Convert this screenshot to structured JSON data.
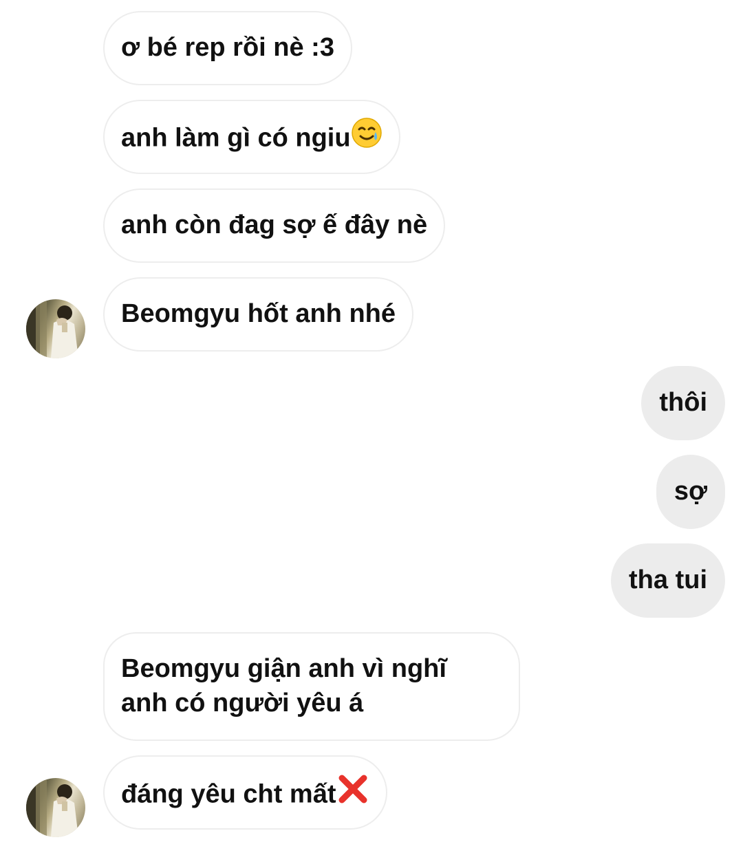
{
  "messages": [
    {
      "id": "m1",
      "side": "incoming",
      "text": "ơ bé rep rồi nè :3"
    },
    {
      "id": "m2",
      "side": "incoming",
      "text": "anh làm gì có ngiu",
      "emoji": "smiling-face-with-tear-emoji"
    },
    {
      "id": "m3",
      "side": "incoming",
      "text": "anh còn đag sợ ế đây nè"
    },
    {
      "id": "m4",
      "side": "incoming",
      "text": "Beomgyu hốt anh nhé",
      "avatar": true
    },
    {
      "id": "m5",
      "side": "outgoing",
      "text": "thôi"
    },
    {
      "id": "m6",
      "side": "outgoing",
      "text": "sợ"
    },
    {
      "id": "m7",
      "side": "outgoing",
      "text": "tha tui"
    },
    {
      "id": "m8",
      "side": "incoming",
      "text_lines": [
        "Beomgyu giận anh vì nghĩ",
        "anh có người yêu á"
      ]
    },
    {
      "id": "m9",
      "side": "incoming",
      "text": "đáng yêu cht mất",
      "emoji": "cross-mark-emoji",
      "avatar": true
    }
  ],
  "colors": {
    "incoming_bubble_bg": "#ffffff",
    "incoming_bubble_border": "#ededed",
    "outgoing_bubble_bg": "#ececec",
    "text": "#111111"
  }
}
